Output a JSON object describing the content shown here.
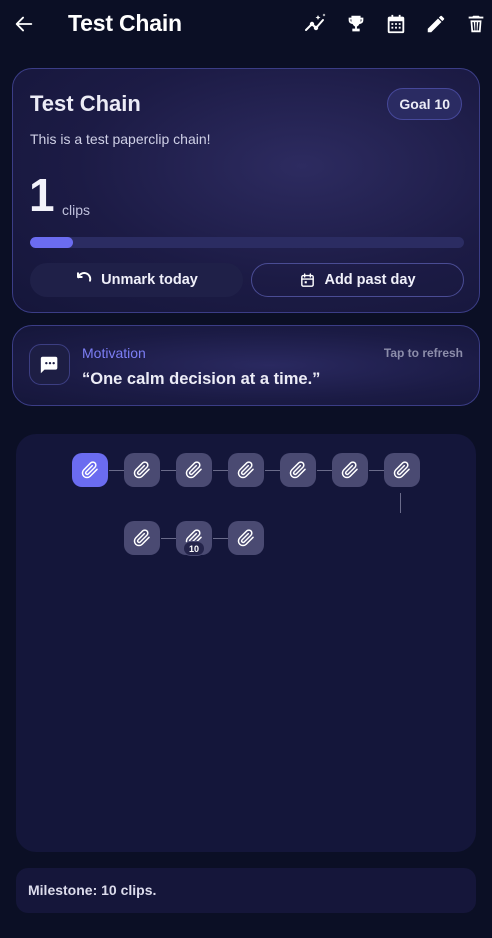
{
  "appbar": {
    "title": "Test Chain",
    "icons": [
      "arrow-left-icon",
      "insights-icon",
      "trophy-icon",
      "calendar-icon",
      "pencil-icon",
      "trash-icon"
    ]
  },
  "chain": {
    "title": "Test Chain",
    "goal_label": "Goal 10",
    "description": "This is a test paperclip chain!",
    "count": "1",
    "count_unit": "clips",
    "progress": 0.1,
    "unmark_label": "Unmark today",
    "add_past_label": "Add past day"
  },
  "motivation": {
    "label": "Motivation",
    "refresh_label": "Tap to refresh",
    "quote": "“One calm decision at a time.”"
  },
  "clips": {
    "total": 10,
    "completed": 1,
    "milestone_badge": "10"
  },
  "milestone": {
    "text": "Milestone: 10 clips."
  },
  "colors": {
    "background": "#0b0f25",
    "accent": "#6b6cf0",
    "clip_inactive": "#4a4a72",
    "card_border": "#3b3d86"
  }
}
